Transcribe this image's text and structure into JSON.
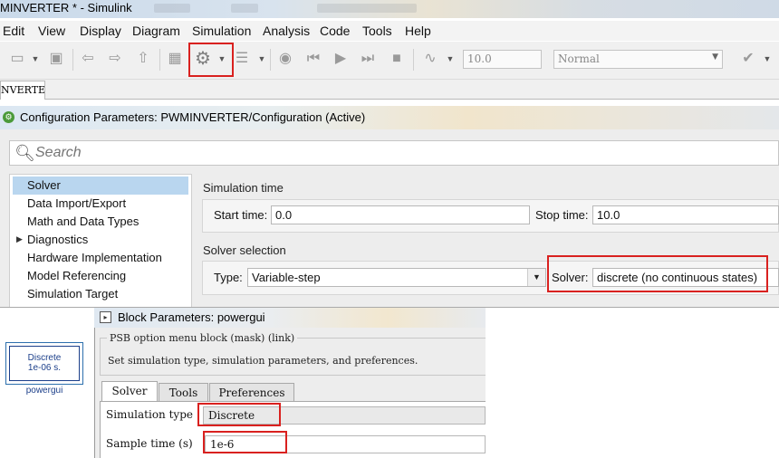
{
  "window": {
    "title": "MINVERTER * - Simulink"
  },
  "menu": [
    "Edit",
    "View",
    "Display",
    "Diagram",
    "Simulation",
    "Analysis",
    "Code",
    "Tools",
    "Help"
  ],
  "toolbar": {
    "stop_time": "10.0",
    "sim_mode": "Normal",
    "icons": [
      "new-model-icon",
      "save-icon",
      "back-icon",
      "forward-icon",
      "up-icon",
      "library-browser-icon",
      "model-configuration-gear-icon",
      "model-explorer-icon",
      "record-icon",
      "step-back-icon",
      "run-icon",
      "step-forward-icon",
      "stop-icon",
      "scope-icon",
      "build-icon"
    ]
  },
  "model_tab": {
    "label": "NVERTER"
  },
  "config_dialog": {
    "title": "Configuration Parameters: PWMINVERTER/Configuration (Active)",
    "search_placeholder": "Search",
    "tree": [
      "Solver",
      "Data Import/Export",
      "Math and Data Types",
      "Diagnostics",
      "Hardware Implementation",
      "Model Referencing",
      "Simulation Target"
    ],
    "selected_tree_item": "Solver",
    "simulation_time": {
      "label": "Simulation time",
      "start_label": "Start time:",
      "start_value": "0.0",
      "stop_label": "Stop time:",
      "stop_value": "10.0"
    },
    "solver_selection": {
      "label": "Solver selection",
      "type_label": "Type:",
      "type_value": "Variable-step",
      "solver_label": "Solver:",
      "solver_value": "discrete (no continuous states)"
    }
  },
  "powergui_block": {
    "text_line1": "Discrete",
    "text_line2": "1e-06 s.",
    "name": "powergui"
  },
  "block_params_dialog": {
    "title": "Block Parameters: powergui",
    "mask_legend": "PSB option menu block (mask) (link)",
    "mask_description": "Set simulation type, simulation parameters, and preferences.",
    "tabs": [
      "Solver",
      "Tools",
      "Preferences"
    ],
    "active_tab": "Solver",
    "sim_type_label": "Simulation type",
    "sim_type_value": "Discrete",
    "sample_time_label": "Sample time (s)",
    "sample_time_value": "1e-6"
  },
  "colors": {
    "highlight_red": "#d9211f",
    "tree_selection": "#b9d6ef",
    "block_blue": "#1c3f8a"
  }
}
